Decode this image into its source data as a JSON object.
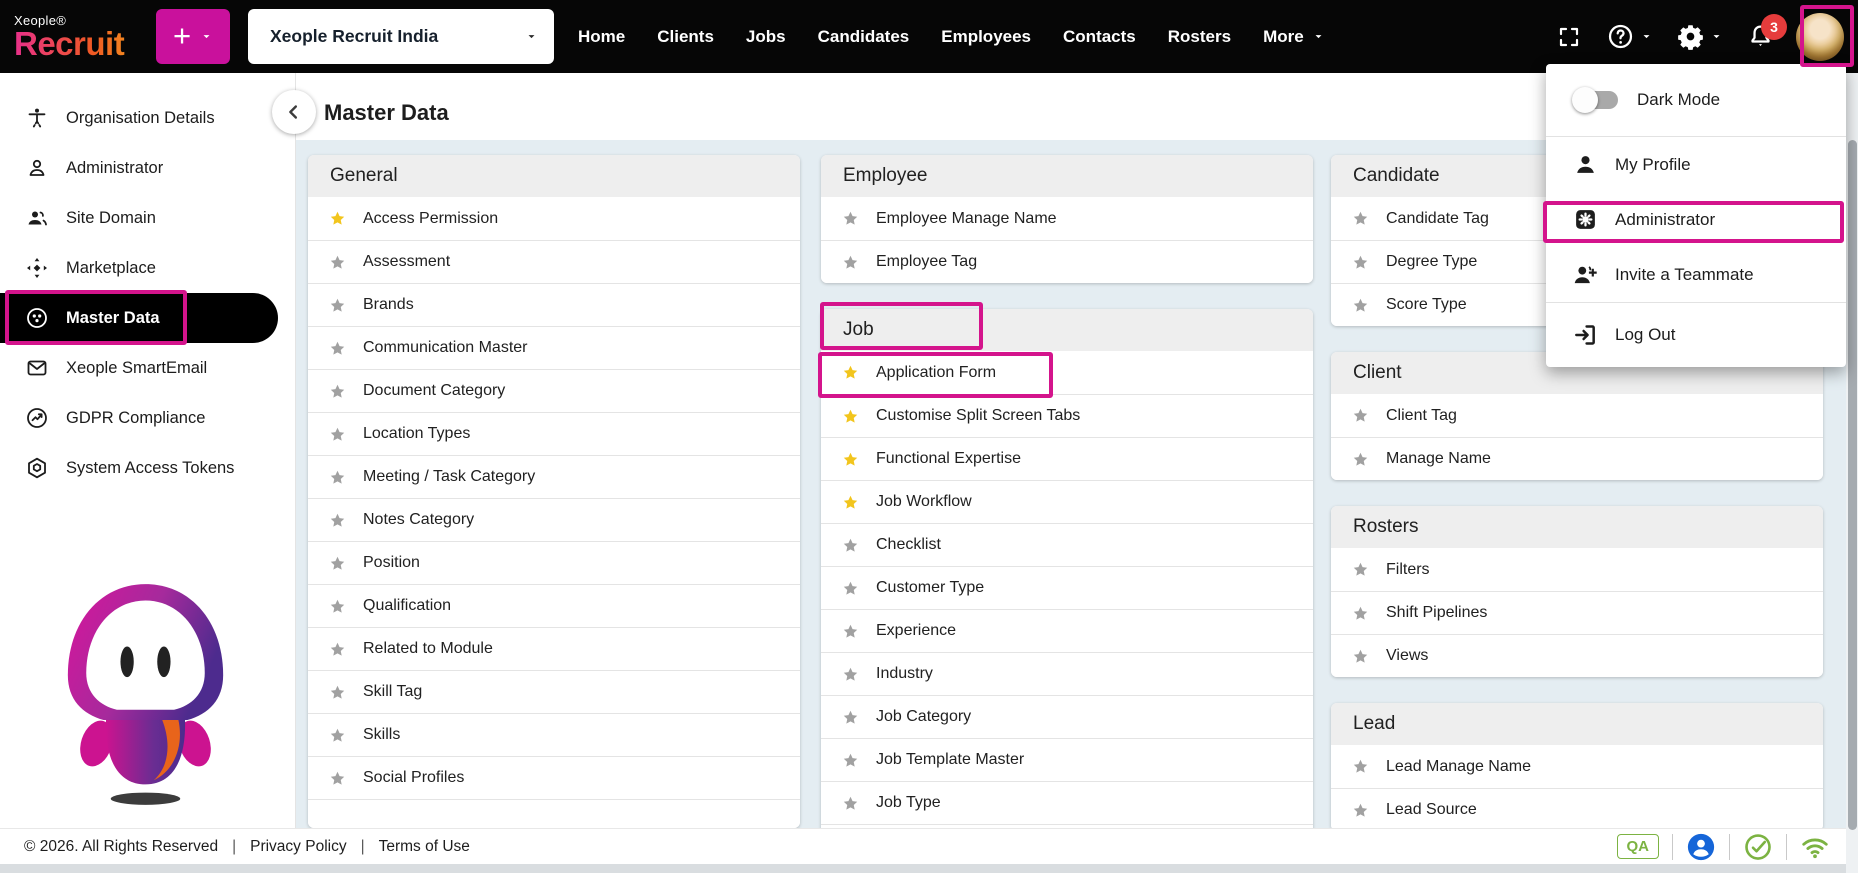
{
  "navbar": {
    "brand_top": "Xeople®",
    "brand_name": "Recruit",
    "add_button_label": "+",
    "org_select_value": "Xeople Recruit India",
    "items": [
      "Home",
      "Clients",
      "Jobs",
      "Candidates",
      "Employees",
      "Contacts",
      "Rosters"
    ],
    "more_label": "More",
    "notification_count": "3"
  },
  "sidebar": {
    "items": [
      {
        "label": "Organisation Details",
        "icon": "accessibility-icon",
        "active": false
      },
      {
        "label": "Administrator",
        "icon": "person-outline-icon",
        "active": false
      },
      {
        "label": "Site Domain",
        "icon": "people-icon",
        "active": false
      },
      {
        "label": "Marketplace",
        "icon": "move-icon",
        "active": false
      },
      {
        "label": "Master Data",
        "icon": "data-circle-icon",
        "active": true
      },
      {
        "label": "Xeople SmartEmail",
        "icon": "envelope-icon",
        "active": false
      },
      {
        "label": "GDPR Compliance",
        "icon": "trending-circle-icon",
        "active": false
      },
      {
        "label": "System Access Tokens",
        "icon": "token-icon",
        "active": false
      }
    ]
  },
  "page": {
    "title": "Master Data"
  },
  "columns": [
    [
      {
        "title": "General",
        "filler": true,
        "items": [
          {
            "label": "Access Permission",
            "starred": true
          },
          {
            "label": "Assessment",
            "starred": false
          },
          {
            "label": "Brands",
            "starred": false
          },
          {
            "label": "Communication Master",
            "starred": false
          },
          {
            "label": "Document Category",
            "starred": false
          },
          {
            "label": "Location Types",
            "starred": false
          },
          {
            "label": "Meeting / Task Category",
            "starred": false
          },
          {
            "label": "Notes Category",
            "starred": false
          },
          {
            "label": "Position",
            "starred": false
          },
          {
            "label": "Qualification",
            "starred": false
          },
          {
            "label": "Related to Module",
            "starred": false
          },
          {
            "label": "Skill Tag",
            "starred": false
          },
          {
            "label": "Skills",
            "starred": false
          },
          {
            "label": "Social Profiles",
            "starred": false
          }
        ]
      }
    ],
    [
      {
        "title": "Employee",
        "filler": false,
        "items": [
          {
            "label": "Employee Manage Name",
            "starred": false
          },
          {
            "label": "Employee Tag",
            "starred": false
          }
        ]
      },
      {
        "title": "Job",
        "filler": true,
        "items": [
          {
            "label": "Application Form",
            "starred": true
          },
          {
            "label": "Customise Split Screen Tabs",
            "starred": true
          },
          {
            "label": "Functional Expertise",
            "starred": true
          },
          {
            "label": "Job Workflow",
            "starred": true
          },
          {
            "label": "Checklist",
            "starred": false
          },
          {
            "label": "Customer Type",
            "starred": false
          },
          {
            "label": "Experience",
            "starred": false
          },
          {
            "label": "Industry",
            "starred": false
          },
          {
            "label": "Job Category",
            "starred": false
          },
          {
            "label": "Job Template Master",
            "starred": false
          },
          {
            "label": "Job Type",
            "starred": false
          }
        ]
      }
    ],
    [
      {
        "title": "Candidate",
        "filler": false,
        "items": [
          {
            "label": "Candidate Tag",
            "starred": false
          },
          {
            "label": "Degree Type",
            "starred": false
          },
          {
            "label": "Score Type",
            "starred": false
          }
        ]
      },
      {
        "title": "Client",
        "filler": false,
        "items": [
          {
            "label": "Client Tag",
            "starred": false
          },
          {
            "label": "Manage Name",
            "starred": false
          }
        ]
      },
      {
        "title": "Rosters",
        "filler": false,
        "items": [
          {
            "label": "Filters",
            "starred": false
          },
          {
            "label": "Shift Pipelines",
            "starred": false
          },
          {
            "label": "Views",
            "starred": false
          }
        ]
      },
      {
        "title": "Lead",
        "filler": false,
        "items": [
          {
            "label": "Lead Manage Name",
            "starred": false
          },
          {
            "label": "Lead Source",
            "starred": false
          }
        ]
      }
    ]
  ],
  "user_menu": {
    "dark_mode_label": "Dark Mode",
    "my_profile_label": "My Profile",
    "administrator_label": "Administrator",
    "invite_label": "Invite a Teammate",
    "logout_label": "Log Out"
  },
  "footer": {
    "copyright": "© 2026. All Rights Reserved",
    "separator": "|",
    "privacy_label": "Privacy Policy",
    "terms_label": "Terms of Use",
    "qa_badge": "QA"
  },
  "colors": {
    "accent": "#d4148c",
    "button": "#c9119c",
    "star": "#f2c51d",
    "badge": "#e63c3c",
    "green": "#7cb342",
    "blue": "#1565d8"
  }
}
